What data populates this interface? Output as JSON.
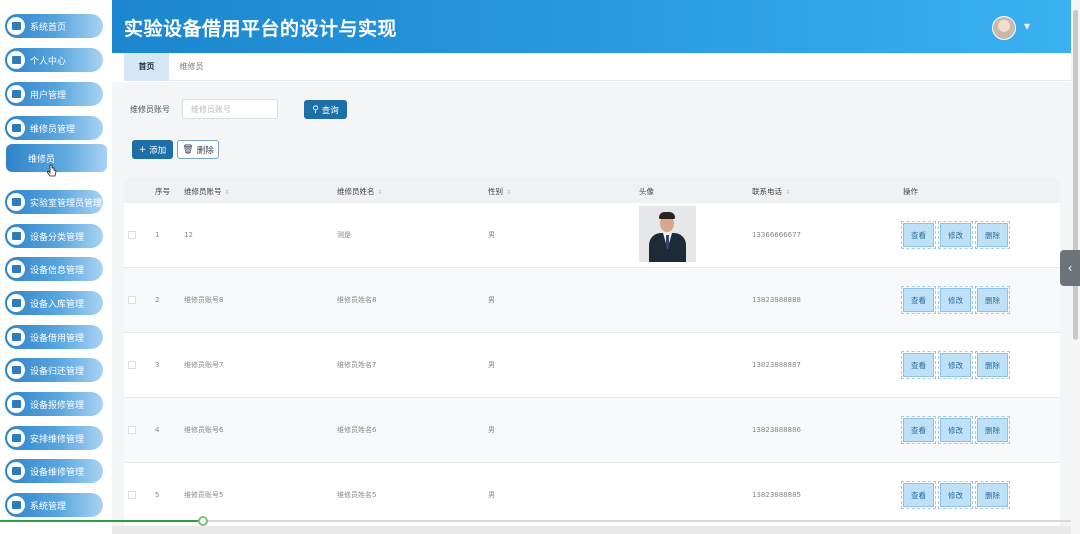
{
  "app": {
    "title": "实验设备借用平台的设计与实现"
  },
  "sidebar": {
    "items": [
      {
        "label": "系统首页",
        "icon": "home-icon"
      },
      {
        "label": "个人中心",
        "icon": "profile-icon"
      },
      {
        "label": "用户管理",
        "icon": "users-icon"
      },
      {
        "label": "维修员管理",
        "icon": "grid-icon"
      },
      {
        "label": "实验室管理员管理",
        "icon": "lab-icon"
      },
      {
        "label": "设备分类管理",
        "icon": "category-icon"
      },
      {
        "label": "设备信息管理",
        "icon": "list-icon"
      },
      {
        "label": "设备入库管理",
        "icon": "grid-icon"
      },
      {
        "label": "设备借用管理",
        "icon": "borrow-icon"
      },
      {
        "label": "设备归还管理",
        "icon": "monitor-icon"
      },
      {
        "label": "设备报修管理",
        "icon": "grid-icon"
      },
      {
        "label": "安排维修管理",
        "icon": "send-icon"
      },
      {
        "label": "设备维修管理",
        "icon": "repair-icon"
      },
      {
        "label": "系统管理",
        "icon": "grid-icon"
      }
    ],
    "active_sub": "维修员"
  },
  "tabs": [
    {
      "label": "首页",
      "active": true
    },
    {
      "label": "维修员",
      "active": false
    }
  ],
  "search": {
    "label": "维修员账号",
    "placeholder": "维修员账号",
    "button": "查询"
  },
  "toolbar": {
    "add": "添加",
    "delete": "删除"
  },
  "table": {
    "headers": [
      "序号",
      "维修员账号",
      "维修员姓名",
      "性别",
      "头像",
      "联系电话",
      "操作"
    ],
    "rows": [
      {
        "no": "1",
        "account": "12",
        "name": "测是",
        "gender": "男",
        "phone": "13366666677",
        "has_photo": true
      },
      {
        "no": "2",
        "account": "维修员账号8",
        "name": "维修员姓名8",
        "gender": "男",
        "phone": "13823888888",
        "has_photo": false
      },
      {
        "no": "3",
        "account": "维修员账号7",
        "name": "维修员姓名7",
        "gender": "男",
        "phone": "13823888887",
        "has_photo": false
      },
      {
        "no": "4",
        "account": "维修员账号6",
        "name": "维修员姓名6",
        "gender": "男",
        "phone": "13823888886",
        "has_photo": false
      },
      {
        "no": "5",
        "account": "维修员账号5",
        "name": "维修员姓名5",
        "gender": "男",
        "phone": "13823888885",
        "has_photo": false
      }
    ],
    "actions": {
      "view": "查看",
      "edit": "修改",
      "delete": "删除"
    }
  },
  "video_progress": 0.19,
  "colors": {
    "header": "#2a9be0",
    "primary_button": "#1e6ea8",
    "action_button": "#bfe1f7",
    "progress": "#2e9e44"
  }
}
